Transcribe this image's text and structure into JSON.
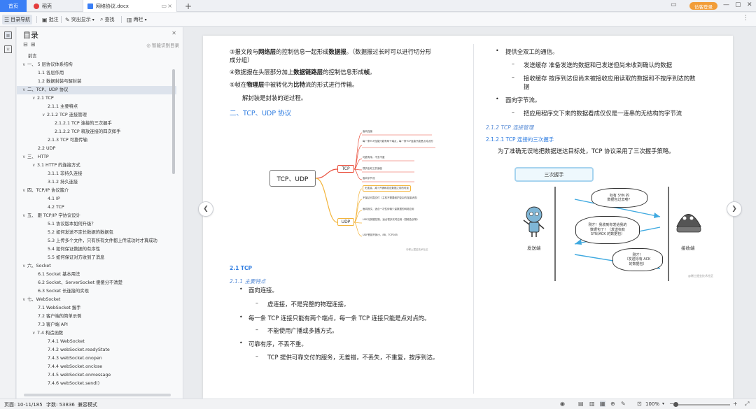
{
  "tabs": {
    "home": "首页",
    "draft": "稻壳",
    "doc": "网络协议.docx",
    "login": "访客登录"
  },
  "toolbar": {
    "nav": "目录导航",
    "comment": "批注",
    "highlight": "突出显示",
    "find": "查找",
    "column": "两栏"
  },
  "nav": {
    "title": "目录",
    "smart": "智能识别目录",
    "items": [
      {
        "label": "前言",
        "level": 0,
        "chev": ""
      },
      {
        "label": "一、 5 层协议体系结构",
        "level": 0,
        "chev": "∨"
      },
      {
        "label": "1.1 各层作用",
        "level": 1,
        "chev": ""
      },
      {
        "label": "1.2 数据封装与解封装",
        "level": 1,
        "chev": ""
      },
      {
        "label": "二、TCP、UDP 协议",
        "level": 0,
        "chev": "∨"
      },
      {
        "label": "2.1 TCP",
        "level": 1,
        "chev": "∨"
      },
      {
        "label": "2.1.1 主要特点",
        "level": 2,
        "chev": ""
      },
      {
        "label": "2.1.2 TCP 连接管理",
        "level": 2,
        "chev": "∨"
      },
      {
        "label": "2.1.2.1 TCP 连接的三次握手",
        "level": 3,
        "chev": ""
      },
      {
        "label": "2.1.2.2 TCP 释放连接的四次挥手",
        "level": 3,
        "chev": ""
      },
      {
        "label": "2.1.3 TCP 可靠传输",
        "level": 2,
        "chev": ""
      },
      {
        "label": "2.2 UDP",
        "level": 1,
        "chev": ""
      },
      {
        "label": "三、 HTTP",
        "level": 0,
        "chev": "∨"
      },
      {
        "label": "3.1 HTTP 的连接方式",
        "level": 1,
        "chev": "∨"
      },
      {
        "label": "3.1.1 非持久连接",
        "level": 2,
        "chev": ""
      },
      {
        "label": "3.1.2 持久连接",
        "level": 2,
        "chev": ""
      },
      {
        "label": "四、TCP/IP 协议簇介",
        "level": 0,
        "chev": "∨"
      },
      {
        "label": "4.1 IP",
        "level": 2,
        "chev": ""
      },
      {
        "label": "4.2 TCP",
        "level": 2,
        "chev": ""
      },
      {
        "label": "五、 跟 TCP/IP 学协议设计",
        "level": 0,
        "chev": "∨"
      },
      {
        "label": "5.1 协议版本如何升级？",
        "level": 2,
        "chev": ""
      },
      {
        "label": "5.2 如何发送不定长数据的数据包",
        "level": 2,
        "chev": ""
      },
      {
        "label": "5.3 上传多个文件，只有所有文件都上传成功时才算成功",
        "level": 2,
        "chev": ""
      },
      {
        "label": "5.4 如何保证数据的有序性",
        "level": 2,
        "chev": ""
      },
      {
        "label": "5.5 如何保证对方收到了消息",
        "level": 2,
        "chev": ""
      },
      {
        "label": "六、Socket",
        "level": 0,
        "chev": "∨"
      },
      {
        "label": "6.1 Socket 基本用法",
        "level": 1,
        "chev": ""
      },
      {
        "label": "6.2 Socket、ServerSocket 傻傻分不清楚",
        "level": 1,
        "chev": ""
      },
      {
        "label": "6.3 Socket 长连接的实现",
        "level": 1,
        "chev": ""
      },
      {
        "label": "七、WebSocket",
        "level": 0,
        "chev": "∨"
      },
      {
        "label": "7.1 WebSocket 握手",
        "level": 1,
        "chev": ""
      },
      {
        "label": "7.2 客户端的简单示例",
        "level": 1,
        "chev": ""
      },
      {
        "label": "7.3 客户端 API",
        "level": 1,
        "chev": ""
      },
      {
        "label": "7.4 构造函数",
        "level": 1,
        "chev": "∨"
      },
      {
        "label": "7.4.1 WebSocket",
        "level": 2,
        "chev": ""
      },
      {
        "label": "7.4.2 webSocket.readyState",
        "level": 2,
        "chev": ""
      },
      {
        "label": "7.4.3 webSocket.onopen",
        "level": 2,
        "chev": ""
      },
      {
        "label": "7.4.4 webSocket.onclose",
        "level": 2,
        "chev": ""
      },
      {
        "label": "7.4.5 webSocket.onmessage",
        "level": 2,
        "chev": ""
      },
      {
        "label": "7.4.6 webSocket.send()",
        "level": 2,
        "chev": ""
      }
    ]
  },
  "doc": {
    "p1": "③报文段与网络层的控制信息一起形成数据报。（数据报过长时可以进行切分形",
    "p1b": "成分组）",
    "p2": "④数据报在头层部分加上数据链路层的控制信息形成帧。",
    "p3": "⑤帧在物理层中被转化为比特流的形式进行传输。",
    "p4": "解封装是封装的逆过程。",
    "h2": "二、TCP、UDP 协议",
    "mm_root": "TCP、UDP",
    "mm_tcp": "TCP",
    "mm_udp": "UDP",
    "mm_tcp_items": [
      "面向连接",
      "每一条TCP连接只能有两个端点，每一条TCP连接只能是点对点的",
      "可靠有序，不丢不重",
      "提供全双工的通信",
      "面向字节流"
    ],
    "mm_udp_items": [
      "无连接，减少开销和发送数据之前的时延",
      "不保证可靠交付（主机不需要维护复杂的连接状态）",
      "面向报文，适合一次性传输少量数据的网络应用",
      "UDP无拥塞控制，适合很多实时应用（视频会议等）",
      "UDP首部开销小，8B，TCP20B"
    ],
    "mm_credit": "@稀土掘金技术社区",
    "h3_tcp": "2.1 TCP",
    "h4_features": "2.1.1 主要特点",
    "f1": "面向连接。",
    "f1a": "虚连接，不是完整的物理连接。",
    "f2": "每一条 TCP 连接只能有两个端点，每一条 TCP 连接只能是点对点的。",
    "f2a": "不能使用广播或多播方式。",
    "f3": "可靠有序，不丢不重。",
    "f3a": "TCP 提供可靠交付的服务，无差错，不丢失，不重复，按序到达。",
    "r1": "提供全双工的通信。",
    "r1a": "发送缓存 准备发送的数据和已发送但尚未收到确认的数据",
    "r1b": "接收缓存 按序到达但尚未被接收应用读取的数据和不按序到达的数",
    "r1c": "据",
    "r2": "面向字节流。",
    "r2a": "把应用程序交下来的数据看成仅仅是一连串的无结构的字节流",
    "h4_mgmt": "2.1.2 TCP 连接管理",
    "h5_handshake": "2.1.2.1 TCP 连接的三次握手",
    "hs_intro": "为了准确无误地把数据送达目标处，TCP 协议采用了三次握手策略。",
    "hs_title": "三次握手",
    "hs_b1": "标有 SYN 的\n数据包过去喽？",
    "hs_b2": "刚才！我收到你发给我的\n数据包了！（发送标有\nSYN/ACK 的数据包）",
    "hs_b3": "刚才！\n（发送标有 ACK\n的数据包）",
    "hs_sender": "发送端",
    "hs_receiver": "接收端",
    "hs_credit": "@稀土掘金技术社区"
  },
  "status": {
    "page": "页面: 10-11/185",
    "words": "字数: 53836",
    "compat": "兼容模式",
    "zoom": "100%"
  },
  "colors": {
    "accent": "#3b7ff6",
    "heading": "#2f7de1",
    "tcp_branch": "#e94d3a",
    "udp_branch": "#f3b43a"
  }
}
